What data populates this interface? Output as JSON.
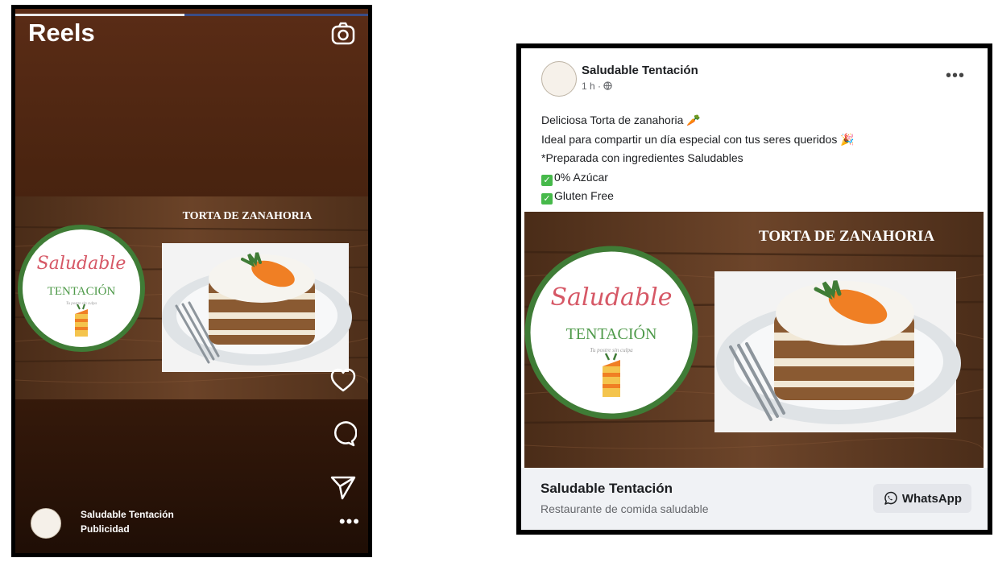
{
  "reels": {
    "title": "Reels",
    "progress": 0.48,
    "ad": {
      "headline": "TORTA DE ZANAHORIA",
      "logo_top": "Saludable",
      "logo_bottom": "TENTACIÓN",
      "logo_tag": "Tu postre sin culpa"
    },
    "account_name": "Saludable Tentación",
    "account_sub": "Publicidad",
    "more_label": "•••",
    "icons": [
      "camera-icon",
      "heart-icon",
      "comment-icon",
      "share-icon"
    ]
  },
  "post": {
    "page_name": "Saludable Tentación",
    "time": "1 h · ",
    "menu_label": "•••",
    "lines": [
      "Deliciosa Torta de zanahoria 🥕",
      "Ideal para compartir un día especial con tus seres queridos 🎉",
      "*Preparada con ingredientes Saludables"
    ],
    "checks": [
      "0% Azúcar",
      "Gluten Free"
    ],
    "check_mark": "✓",
    "ad": {
      "headline": "TORTA DE ZANAHORIA",
      "logo_top": "Saludable",
      "logo_bottom": "TENTACIÓN",
      "logo_tag": "Tu postre sin culpa"
    },
    "cta": {
      "name": "Saludable Tentación",
      "description": "Restaurante de comida saludable",
      "button": "WhatsApp"
    }
  },
  "colors": {
    "reels_bg": "#4a2410",
    "wood": "#5e3a22",
    "logo_ring": "#3f7c36",
    "logo_pink": "#d65866",
    "logo_green": "#4f9a4a",
    "carrot": "#f07f24",
    "check_green": "#46b94a",
    "fb_cta_bg": "#f0f2f5"
  }
}
